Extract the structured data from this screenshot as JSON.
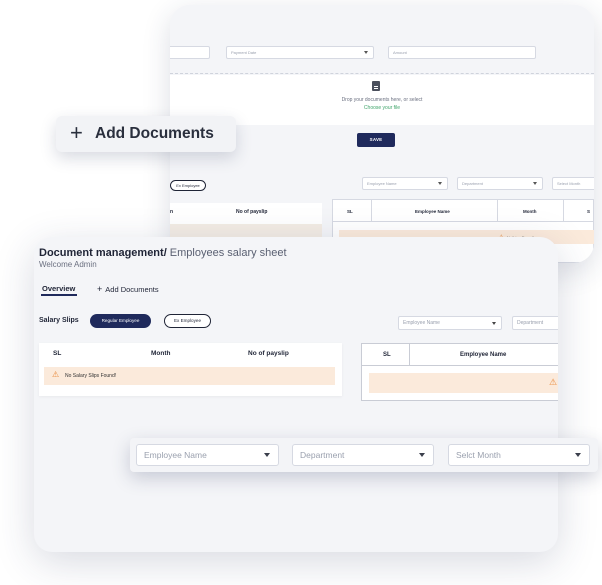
{
  "back_panel": {
    "form": {
      "payment_date_placeholder": "Payment Date",
      "amount_placeholder": "Amount"
    },
    "upload": {
      "drop_text": "Drop your documents here, or select",
      "choose_link": "Choose your file",
      "save_label": "SAVE"
    },
    "ex_employee_pill": "Ex Employee",
    "filters": {
      "employee_name": "Employee Name",
      "department": "Department",
      "select_month": "Select Month"
    },
    "left_table": {
      "col_partial": "n",
      "col_payslip": "No of payslip"
    },
    "right_table": {
      "col_sl": "SL",
      "col_employee": "Employee Name",
      "col_month": "Month",
      "col_extra": "S",
      "empty_text": "Nothing Found!"
    }
  },
  "add_documents_pill": {
    "icon": "plus-icon",
    "label": "Add Documents"
  },
  "front_panel": {
    "title_bold": "Document management/",
    "title_rest": " Employees salary sheet",
    "welcome": "Welcome Admin",
    "tabs": [
      {
        "label": "Overview",
        "active": true
      },
      {
        "label": "Add Documents",
        "icon": "plus-icon"
      }
    ],
    "section_label": "Salary Slips",
    "type_pills": {
      "regular": "Regular Employee",
      "ex": "Ex Employee"
    },
    "filters": {
      "employee_name": "Employee Name",
      "department": "Department"
    },
    "left_table": {
      "columns": [
        "SL",
        "Month",
        "No of payslip"
      ],
      "empty_text": "No Salary Slips Found!"
    },
    "right_table": {
      "columns": [
        "SL",
        "Employee Name"
      ]
    }
  },
  "filter_bar": {
    "employee_name": "Employee Name",
    "department": "Department",
    "select_month": "Selct Month"
  },
  "colors": {
    "primary": "#1f2a5c",
    "warning_bg": "#fbeadb",
    "warning_icon": "#e8893a",
    "link": "#3fa46a"
  }
}
